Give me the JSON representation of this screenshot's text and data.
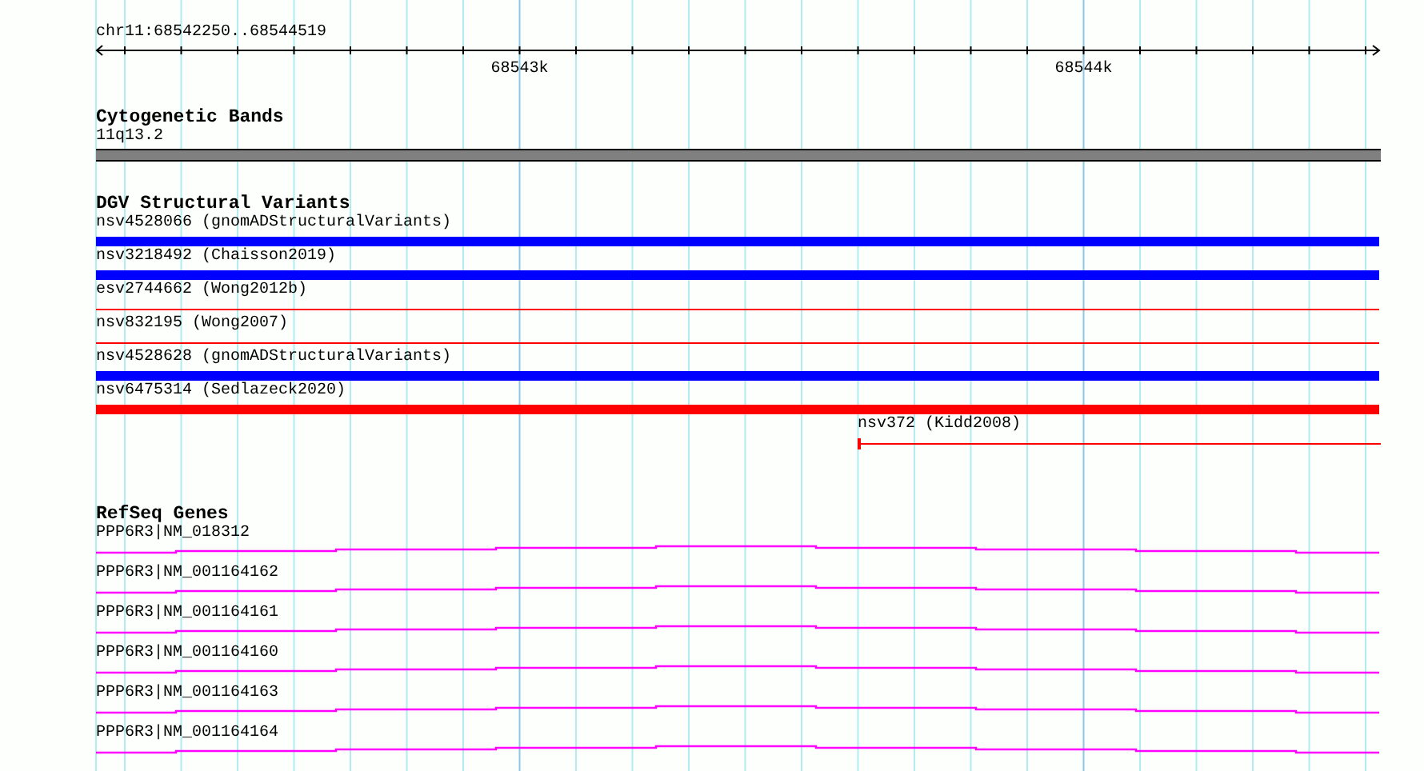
{
  "ruler": {
    "range": "chr11:68542250..68544519",
    "tick_labels": [
      "68543k",
      "68544k"
    ]
  },
  "tracks": [
    {
      "kind": "cytoband",
      "title": "Cytogenetic Bands",
      "features": [
        {
          "label": "11q13.2"
        }
      ]
    },
    {
      "kind": "variants",
      "title": "DGV Structural Variants",
      "features": [
        {
          "label": "nsv4528066 (gnomADStructuralVariants)",
          "kind": "thick",
          "color": "#0000ff"
        },
        {
          "label": "nsv3218492 (Chaisson2019)",
          "kind": "thick",
          "color": "#0000ff"
        },
        {
          "label": "esv2744662 (Wong2012b)",
          "kind": "thin",
          "color": "#ff0000"
        },
        {
          "label": "nsv832195 (Wong2007)",
          "kind": "thin",
          "color": "#ff0000"
        },
        {
          "label": "nsv4528628 (gnomADStructuralVariants)",
          "kind": "thick",
          "color": "#0000ff"
        },
        {
          "label": "nsv6475314 (Sedlazeck2020)",
          "kind": "thick",
          "color": "#ff0000"
        },
        {
          "label": "nsv372 (Kidd2008)",
          "kind": "partial",
          "color": "#ff0000"
        }
      ]
    },
    {
      "kind": "genes",
      "title": "RefSeq Genes",
      "features": [
        {
          "label": "PPP6R3|NM_018312"
        },
        {
          "label": "PPP6R3|NM_001164162"
        },
        {
          "label": "PPP6R3|NM_001164161"
        },
        {
          "label": "PPP6R3|NM_001164160"
        },
        {
          "label": "PPP6R3|NM_001164163"
        },
        {
          "label": "PPP6R3|NM_001164164"
        }
      ]
    }
  ]
}
